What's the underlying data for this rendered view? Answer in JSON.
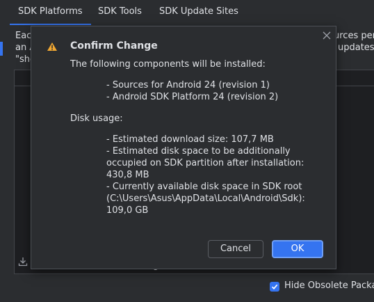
{
  "tabs": [
    {
      "label": "SDK Platforms",
      "active": true
    },
    {
      "label": "SDK Tools",
      "active": false
    },
    {
      "label": "SDK Update Sites",
      "active": false
    }
  ],
  "background": {
    "fragment_left_1": "Eac",
    "fragment_left_2": "an A",
    "fragment_left_3": "\"sho",
    "fragment_right_1": "urces per",
    "fragment_right_2": "updates",
    "fragment_bottom": "g",
    "hide_obsolete_label": "Hide Obsolete Packa",
    "hide_obsolete_checked": true
  },
  "dialog": {
    "title": "Confirm Change",
    "intro": "The following components will be installed:",
    "components": [
      "- Sources for Android 24 (revision 1)",
      "- Android SDK Platform 24 (revision 2)"
    ],
    "disk_usage_label": "Disk usage:",
    "disk_lines": [
      "- Estimated download size: 107,7 MB",
      "- Estimated disk space to be additionally",
      "occupied on SDK partition after installation:",
      "430,8 MB",
      "- Currently available disk space in SDK root",
      "(C:\\Users\\Asus\\AppData\\Local\\Android\\Sdk):",
      "109,0 GB"
    ],
    "cancel_label": "Cancel",
    "ok_label": "OK"
  },
  "colors": {
    "accent": "#3574f0",
    "warning": "#f0a732",
    "background": "#2b2d30"
  },
  "icons": [
    "warning-icon",
    "close-icon",
    "download-icon",
    "checkmark-icon"
  ]
}
